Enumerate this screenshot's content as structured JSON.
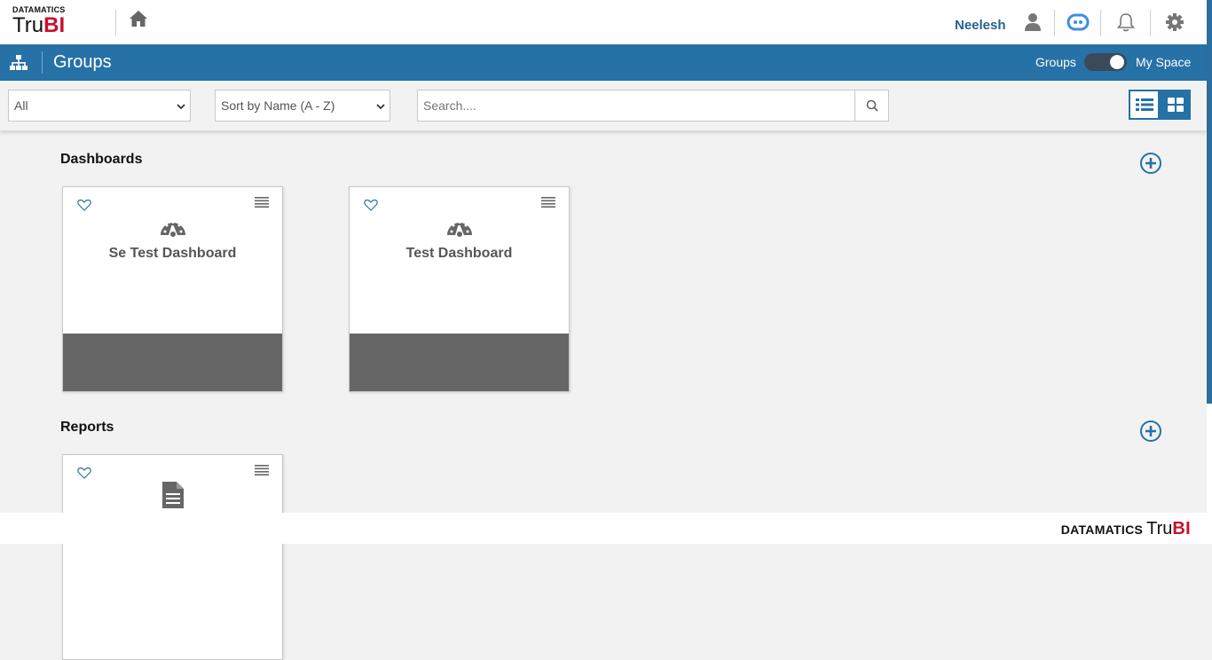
{
  "header": {
    "logo_small": "DATAMATICS",
    "logo_tru": "Tru",
    "logo_bi": "BI",
    "username": "Neelesh",
    "icons": [
      "home-icon",
      "user-icon",
      "chatbot-icon",
      "bell-icon",
      "gear-icon"
    ]
  },
  "titlebar": {
    "title": "Groups",
    "toggle_left": "Groups",
    "toggle_right": "My Space",
    "icon": "sitemap-icon"
  },
  "filters": {
    "category_value": "All",
    "sort_value": "Sort by Name (A - Z)",
    "search_placeholder": "Search....",
    "search_icon": "search-icon",
    "view_icons": [
      "list-view-icon",
      "grid-view-icon"
    ]
  },
  "sections": {
    "dashboards": {
      "title": "Dashboards",
      "cards": [
        {
          "title": "Se Test Dashboard",
          "icon": "dashboard-gauge-icon"
        },
        {
          "title": "Test Dashboard",
          "icon": "dashboard-gauge-icon"
        }
      ]
    },
    "reports": {
      "title": "Reports",
      "cards": [
        {
          "title": "",
          "icon": "report-document-icon"
        }
      ]
    }
  },
  "footer": {
    "brand_prefix": "DATAMATICS",
    "brand_tru": "Tru",
    "brand_bi": "BI"
  },
  "colors": {
    "primary": "#2671a6",
    "accent_red": "#c8102e",
    "username": "#23638f",
    "card_thumb": "#666666"
  }
}
